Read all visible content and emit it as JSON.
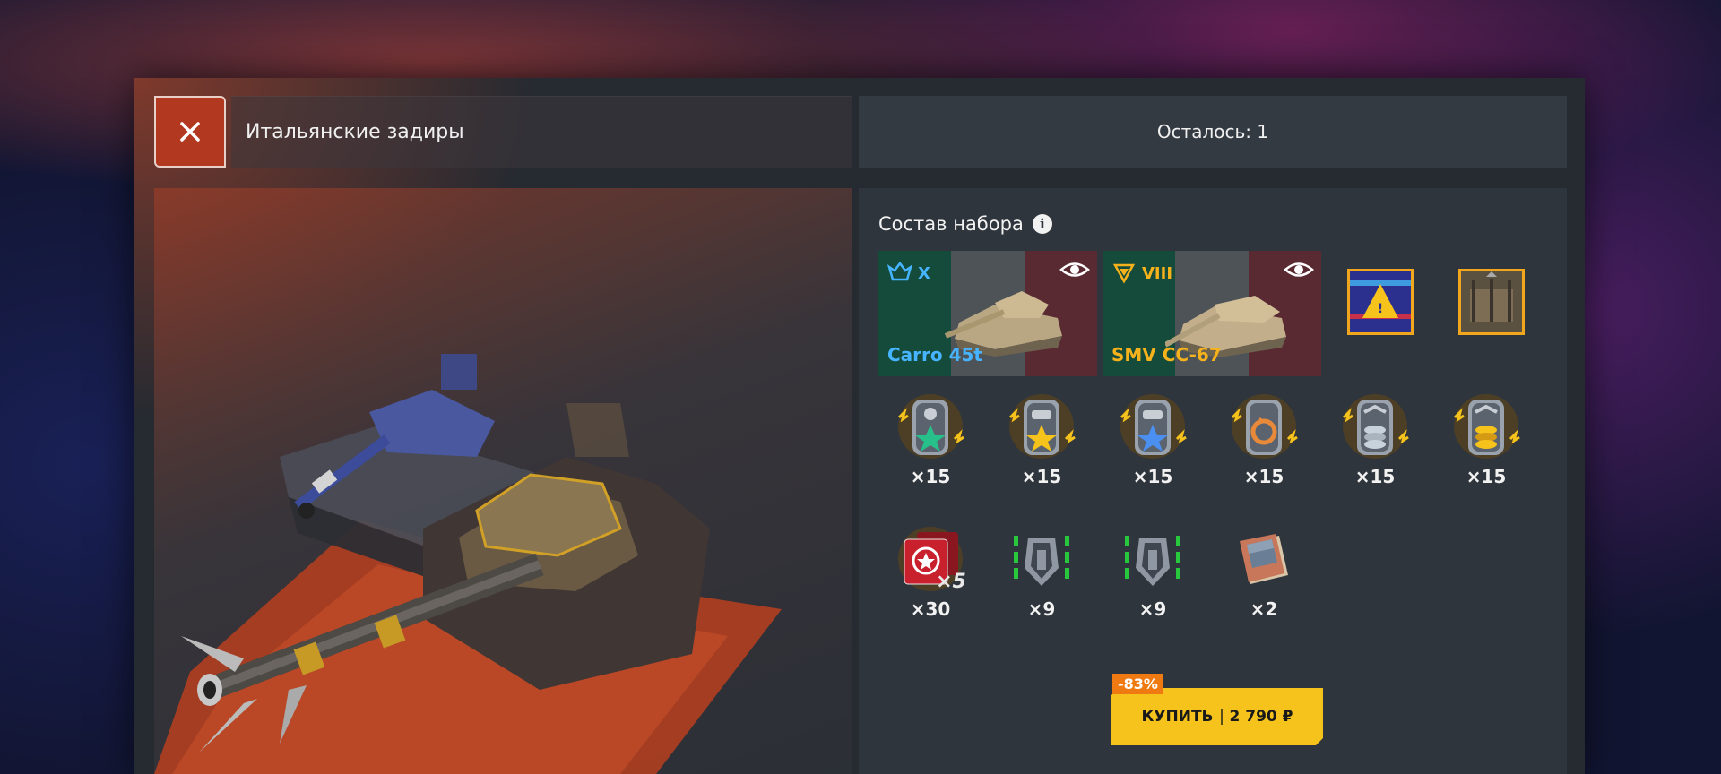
{
  "header": {
    "close_label": "×",
    "title": "Итальянские задиры",
    "remaining": "Осталось: 1"
  },
  "content": {
    "section_title": "Состав набора",
    "tanks": [
      {
        "tier": "X",
        "name": "Carro 45t",
        "name_color": "#46b4ff",
        "tier_color": "#46b4ff"
      },
      {
        "tier": "VIII",
        "name": "SMV CC-67",
        "name_color": "#f6b21c",
        "tier_color": "#f6b21c"
      }
    ],
    "rewards_row1": [
      {
        "icon": "crew-green-star-icon",
        "qty": "×15"
      },
      {
        "icon": "tank-gold-star-icon",
        "qty": "×15"
      },
      {
        "icon": "tank-blue-star-icon",
        "qty": "×15"
      },
      {
        "icon": "retrain-icon",
        "qty": "×15"
      },
      {
        "icon": "silver-coins-icon",
        "qty": "×15"
      },
      {
        "icon": "gold-coins-icon",
        "qty": "×15"
      }
    ],
    "rewards_row2": [
      {
        "icon": "premium-cards-icon",
        "badge": "×5",
        "qty": "×30"
      },
      {
        "icon": "equipment-shield-icon",
        "qty": "×9"
      },
      {
        "icon": "equipment-shield-icon",
        "qty": "×9"
      },
      {
        "icon": "blueprint-box-icon",
        "qty": "×2"
      }
    ],
    "buy": {
      "discount": "-83%",
      "label": "КУПИТЬ",
      "price": "2 790 ₽"
    }
  },
  "colors": {
    "accent_buy": "#f6c21c",
    "discount": "#f07a12",
    "close_bg": "#b2391f"
  }
}
